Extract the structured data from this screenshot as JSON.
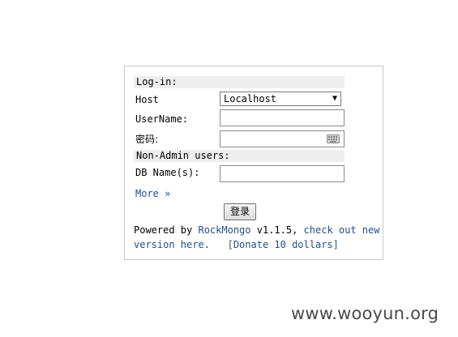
{
  "login": {
    "section_title": "Log-in:",
    "host_label": "Host",
    "host_selected": "Localhost",
    "username_label": "UserName:",
    "username_value": "",
    "password_label": "密码:",
    "password_value": ""
  },
  "non_admin": {
    "section_title": "Non-Admin users:",
    "dbname_label": "DB Name(s):",
    "dbname_value": ""
  },
  "more_link": "More »",
  "login_button": "登录",
  "footer": {
    "powered_by": "Powered by ",
    "rockmongo_link": "RockMongo",
    "version": " v1.1.5, ",
    "check_link_part1": "check out new",
    "check_link_part2": "version here.",
    "donate_link": "[Donate 10 dollars]"
  },
  "watermark": "www.wooyun.org",
  "icons": {
    "host_select_arrow": "triangle-down-icon",
    "password_keyboard": "keyboard-icon"
  },
  "colors": {
    "link": "#1f4f8f",
    "section_header_bg": "#eeeeee",
    "panel_border": "#c8c8c8"
  }
}
